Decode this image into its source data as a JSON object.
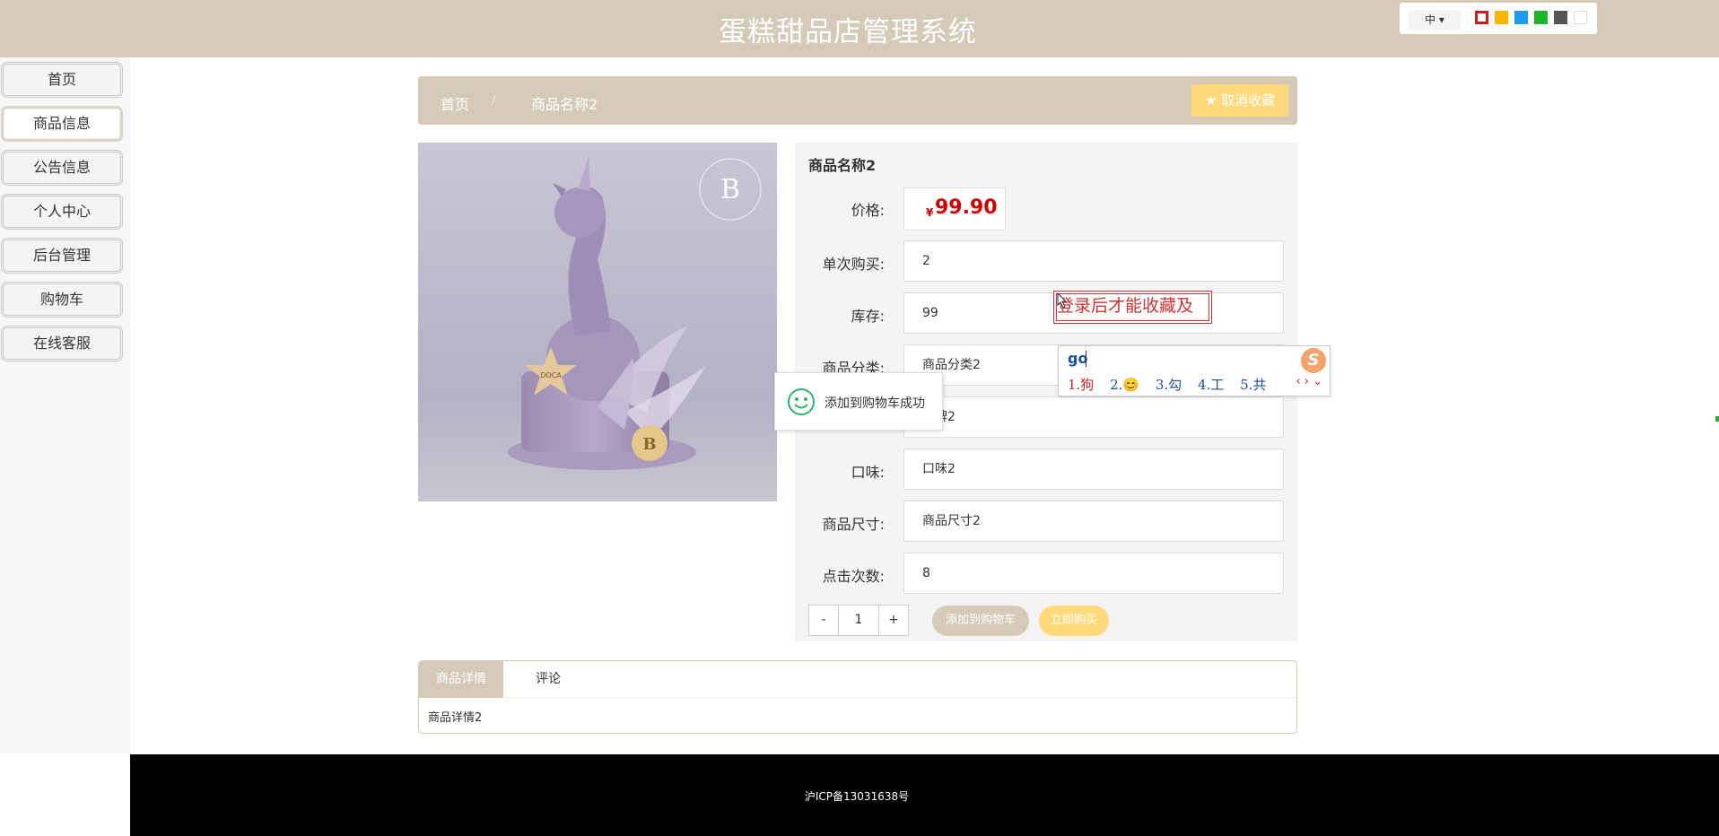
{
  "header": {
    "title": "蛋糕甜品店管理系统",
    "lang_select": "中 ▾",
    "theme_swatches": [
      "#d11a1a",
      "#f7b500",
      "#1e9bf0",
      "#1fb32b",
      "#555555",
      "#ffffff"
    ]
  },
  "sidebar": {
    "items": [
      {
        "label": "首页"
      },
      {
        "label": "商品信息"
      },
      {
        "label": "公告信息"
      },
      {
        "label": "个人中心"
      },
      {
        "label": "后台管理"
      },
      {
        "label": "购物车"
      },
      {
        "label": "在线客服"
      }
    ]
  },
  "breadcrumb": {
    "home": "首页",
    "separator": "/",
    "current": "商品名称2",
    "fav_button": "★ 取消收藏"
  },
  "product": {
    "name": "商品名称2",
    "price_label": "价格:",
    "currency": "¥",
    "price": "99.90",
    "fields": [
      {
        "label": "单次购买:",
        "value": "2"
      },
      {
        "label": "库存:",
        "value": "99"
      },
      {
        "label": "商品分类:",
        "value": "商品分类2"
      },
      {
        "label": "",
        "value": "品牌2"
      },
      {
        "label": "口味:",
        "value": "口味2"
      },
      {
        "label": "商品尺寸:",
        "value": "商品尺寸2"
      },
      {
        "label": "点击次数:",
        "value": "8"
      }
    ],
    "qty_minus": "-",
    "qty_value": "1",
    "qty_plus": "+",
    "add_cart": "添加到购物车",
    "buy_now": "立即购买"
  },
  "login_tip": "登录后才能收藏及",
  "ime": {
    "input": "go",
    "candidates": [
      "1.狗",
      "2.😊",
      "3.勾",
      "4.工",
      "5.共"
    ],
    "logo": "S",
    "nav": "‹ › ⌄"
  },
  "toast": {
    "text": "添加到购物车成功"
  },
  "tabs": {
    "active": "商品详情",
    "other": "评论",
    "content": "商品详情2"
  },
  "footer": {
    "text": "沪ICP备13031638号"
  },
  "colors": {
    "theme": "#d4cab7",
    "accent": "#ffd97a",
    "price": "#cc0000"
  }
}
